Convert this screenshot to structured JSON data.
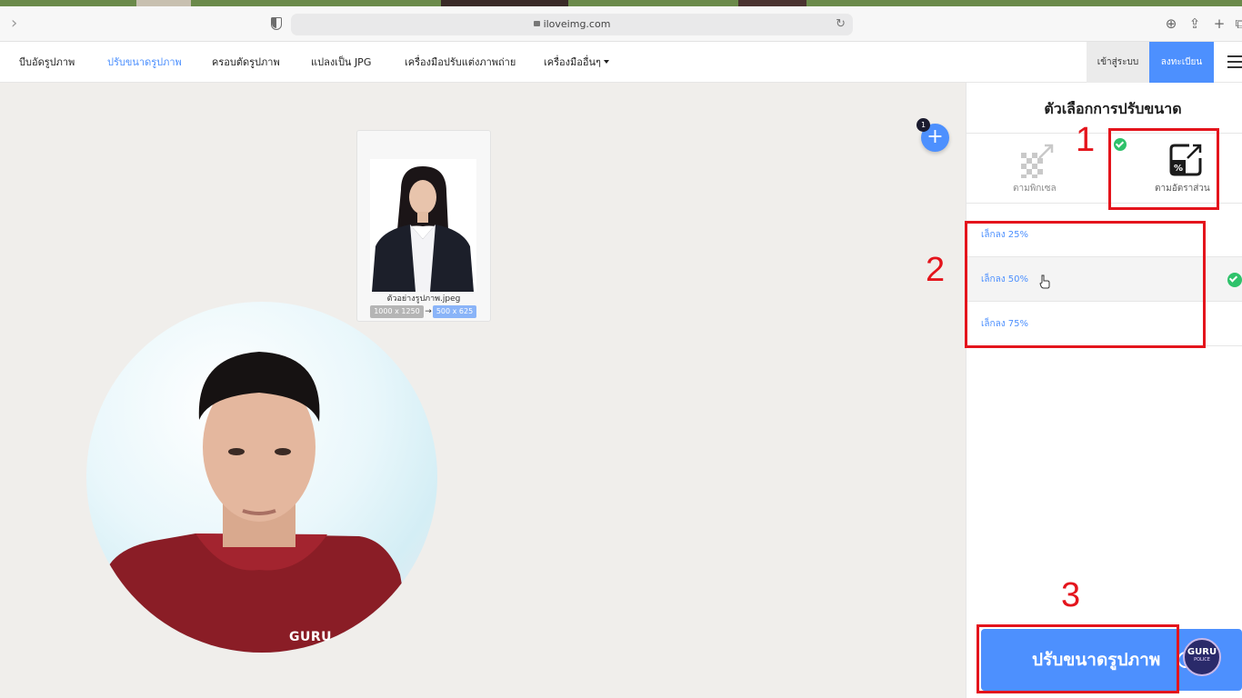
{
  "browser": {
    "url": "iloveimg.com"
  },
  "nav": {
    "items": [
      {
        "label": "บีบอัดรูปภาพ"
      },
      {
        "label": "ปรับขนาดรูปภาพ"
      },
      {
        "label": "ครอบตัดรูปภาพ"
      },
      {
        "label": "แปลงเป็น JPG"
      },
      {
        "label": "เครื่องมือปรับแต่งภาพถ่าย"
      },
      {
        "label": "เครื่องมืออื่นๆ"
      }
    ],
    "login": "เข้าสู่ระบบ",
    "signup": "ลงทะเบียน"
  },
  "file": {
    "name": "ตัวอย่างรูปภาพ.jpeg",
    "original_size": "1000 x 1250",
    "arrow": "→",
    "new_size": "500 x 625",
    "count_badge": "1"
  },
  "panel": {
    "title": "ตัวเลือกการปรับขนาด",
    "modes": [
      {
        "label": "ตามพิกเซล",
        "selected": false
      },
      {
        "label": "ตามอัตราส่วน",
        "selected": true
      }
    ],
    "options": [
      {
        "label": "เล็กลง 25%",
        "selected": false
      },
      {
        "label": "เล็กลง 50%",
        "selected": true
      },
      {
        "label": "เล็กลง 75%",
        "selected": false
      }
    ],
    "submit": "ปรับขนาดรูปภาพ"
  },
  "overlay": {
    "shirt_logo": "GURU",
    "brand_badge_top": "GURU",
    "brand_badge_bottom": "POLICE"
  },
  "annotations": [
    "1",
    "2",
    "3"
  ],
  "colors": {
    "accent": "#4d90fe",
    "annotation_red": "#e4141c",
    "check_green": "#2fc26b"
  },
  "icons": {
    "add": "plus-icon",
    "pixel_mode": "pixel-resize-icon",
    "percent_mode": "percentage-resize-icon",
    "check": "check-icon"
  }
}
